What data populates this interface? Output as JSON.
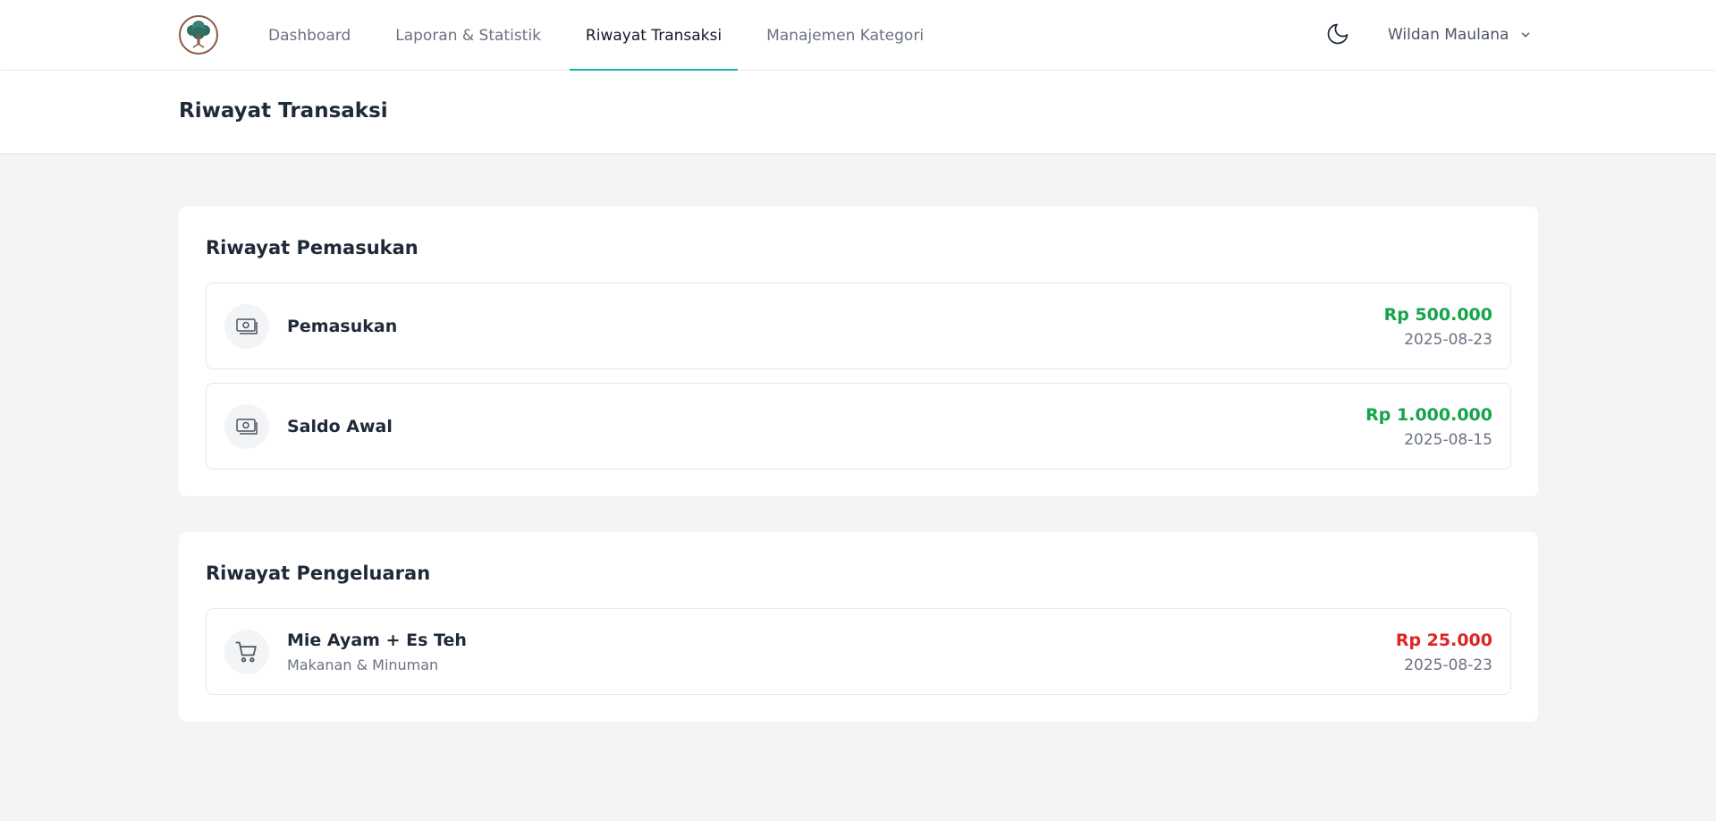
{
  "nav": {
    "links": [
      {
        "label": "Dashboard",
        "active": false
      },
      {
        "label": "Laporan & Statistik",
        "active": false
      },
      {
        "label": "Riwayat Transaksi",
        "active": true
      },
      {
        "label": "Manajemen Kategori",
        "active": false
      }
    ],
    "user_name": "Wildan Maulana"
  },
  "page": {
    "title": "Riwayat Transaksi"
  },
  "income": {
    "title": "Riwayat Pemasukan",
    "items": [
      {
        "name": "Pemasukan",
        "amount": "Rp 500.000",
        "date": "2025-08-23",
        "icon": "cash-icon"
      },
      {
        "name": "Saldo Awal",
        "amount": "Rp 1.000.000",
        "date": "2025-08-15",
        "icon": "cash-icon"
      }
    ]
  },
  "expense": {
    "title": "Riwayat Pengeluaran",
    "items": [
      {
        "name": "Mie Ayam + Es Teh",
        "category": "Makanan & Minuman",
        "amount": "Rp 25.000",
        "date": "2025-08-23",
        "icon": "shopping-cart-icon"
      }
    ]
  },
  "colors": {
    "accent": "#14b8a6",
    "income_amount": "#16a34a",
    "expense_amount": "#dc2626",
    "background": "#f3f4f6",
    "logo_green": "#2f6f63",
    "logo_brown": "#8a5a44"
  }
}
